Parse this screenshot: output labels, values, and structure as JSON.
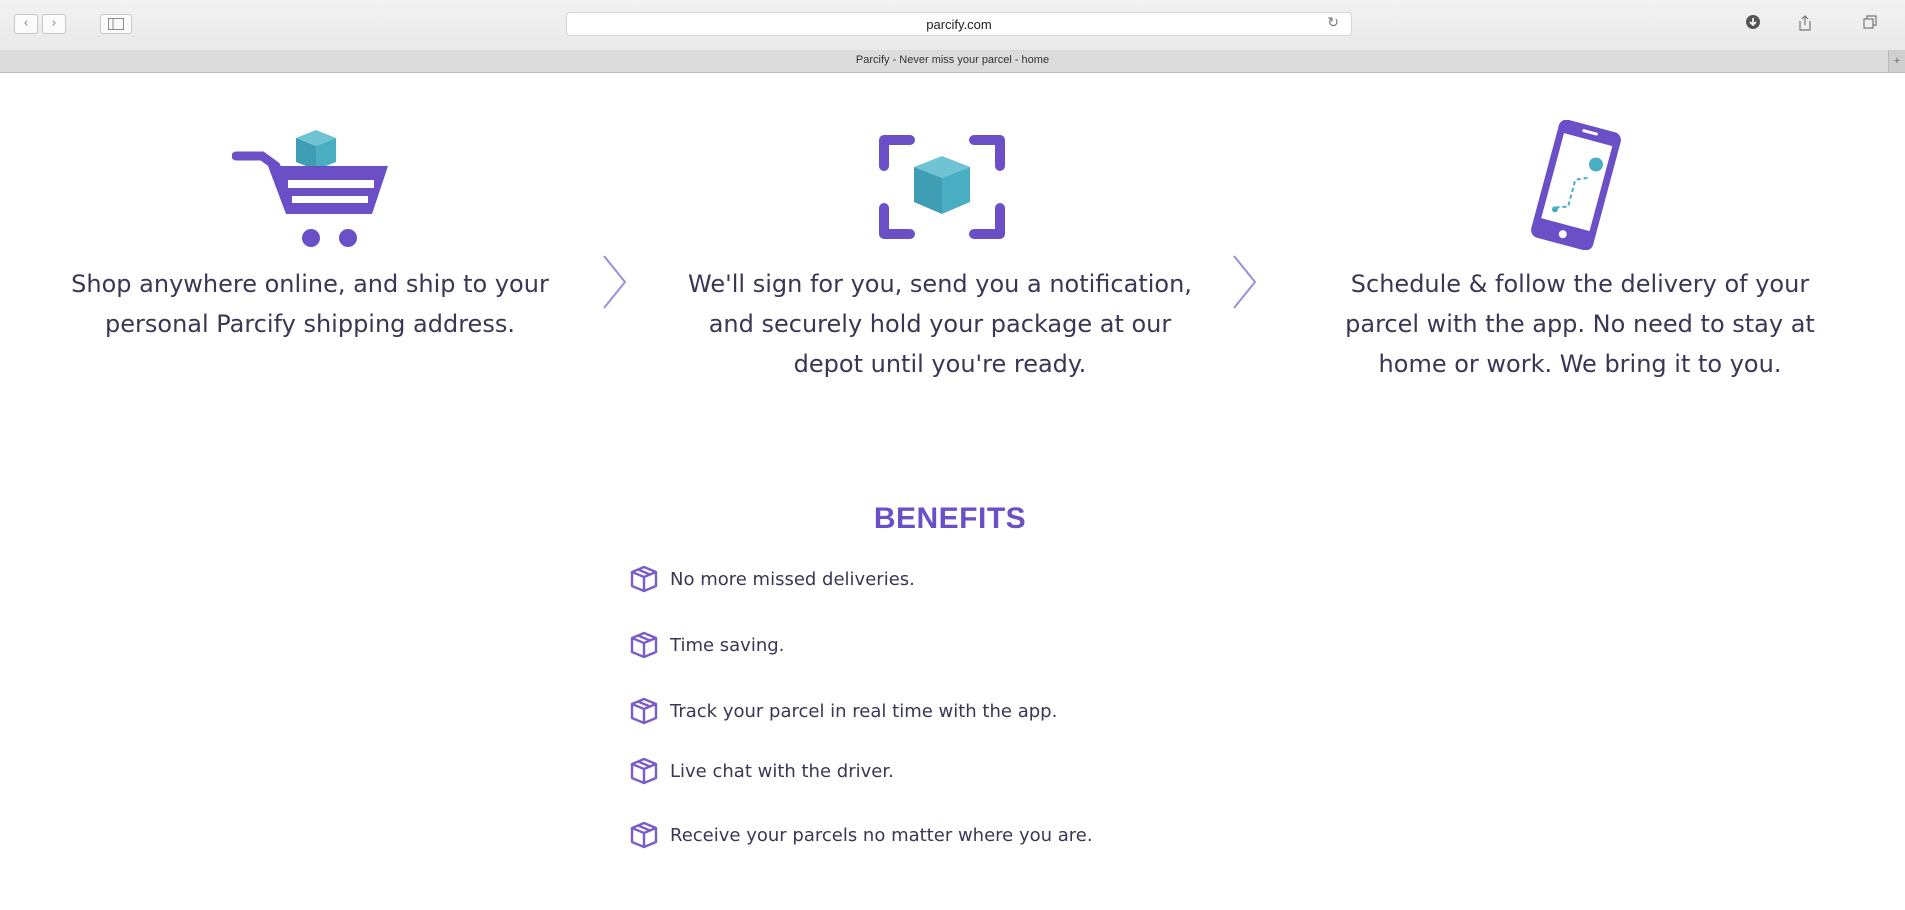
{
  "browser": {
    "url": "parcify.com",
    "tab_title": "Parcify - Never miss your parcel - home",
    "back_glyph": "‹",
    "forward_glyph": "›",
    "reload_glyph": "↻",
    "new_tab_glyph": "+"
  },
  "steps": [
    {
      "icon": "shopping-cart-icon",
      "text_line1": "Shop anywhere online, and ship to your",
      "text_line2": "personal Parcify shipping address."
    },
    {
      "icon": "scan-box-icon",
      "text_line1": "We'll sign for you, send you a notification,",
      "text_line2": "and securely hold your package at our",
      "text_line3": "depot until you're ready."
    },
    {
      "icon": "phone-tracking-icon",
      "text_line1": "Schedule & follow the delivery of your",
      "text_line2": "parcel with the app. No need to stay at",
      "text_line3": "home or work. We bring it to you."
    }
  ],
  "benefits": {
    "title": "BENEFITS",
    "items": [
      "No more missed deliveries.",
      "Time saving.",
      "Track your parcel in real time with the app.",
      "Live chat with the driver.",
      "Receive your parcels no matter where you are."
    ]
  },
  "colors": {
    "purple": "#6a4fc7",
    "teal": "#4aaec3",
    "text": "#3c3553"
  }
}
